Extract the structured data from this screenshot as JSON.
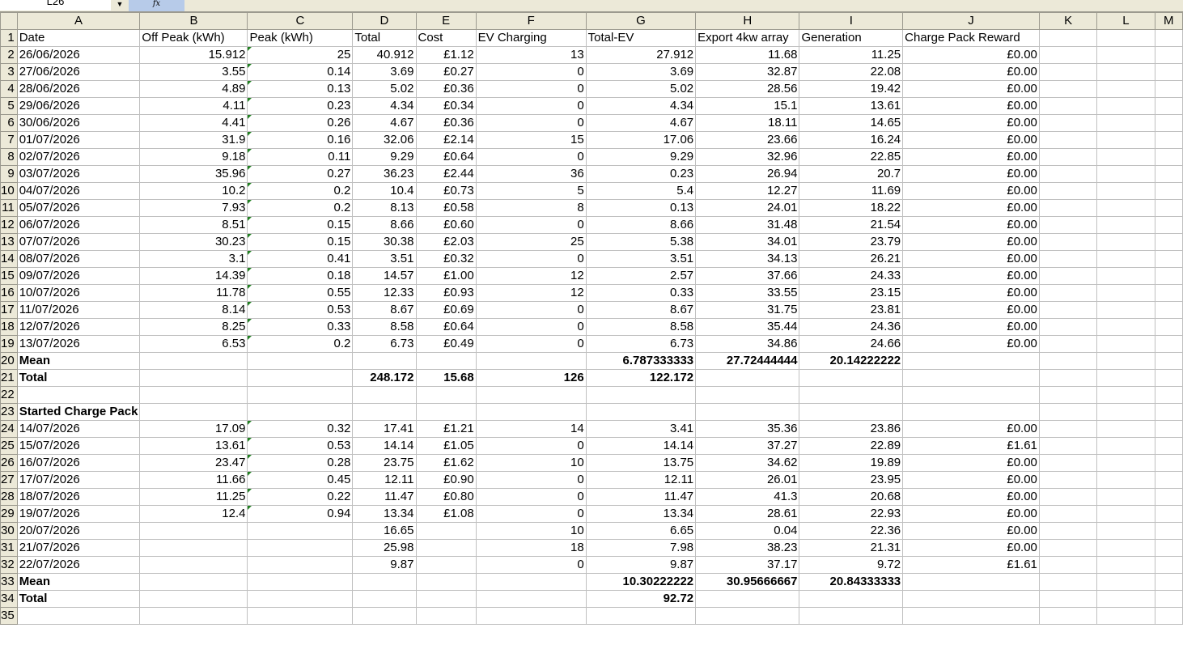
{
  "toolbar": {
    "namebox": "L26",
    "fx": "fx"
  },
  "columns": [
    "A",
    "B",
    "C",
    "D",
    "E",
    "F",
    "G",
    "H",
    "I",
    "J",
    "K",
    "L",
    "M"
  ],
  "row_numbers": [
    "1",
    "2",
    "3",
    "4",
    "5",
    "6",
    "7",
    "8",
    "9",
    "10",
    "11",
    "12",
    "13",
    "14",
    "15",
    "16",
    "17",
    "18",
    "19",
    "20",
    "21",
    "22",
    "23",
    "24",
    "25",
    "26",
    "27",
    "28",
    "29",
    "30",
    "31",
    "32",
    "33",
    "34",
    "35"
  ],
  "headers": [
    "Date",
    "Off Peak (kWh)",
    "Peak (kWh)",
    "Total",
    "Cost",
    "EV Charging",
    "Total-EV",
    "Export 4kw array",
    "Generation",
    "Charge Pack Reward"
  ],
  "rows1": [
    [
      "26/06/2026",
      "15.912",
      "25",
      "40.912",
      "£1.12",
      "13",
      "27.912",
      "11.68",
      "11.25",
      "£0.00"
    ],
    [
      "27/06/2026",
      "3.55",
      "0.14",
      "3.69",
      "£0.27",
      "0",
      "3.69",
      "32.87",
      "22.08",
      "£0.00"
    ],
    [
      "28/06/2026",
      "4.89",
      "0.13",
      "5.02",
      "£0.36",
      "0",
      "5.02",
      "28.56",
      "19.42",
      "£0.00"
    ],
    [
      "29/06/2026",
      "4.11",
      "0.23",
      "4.34",
      "£0.34",
      "0",
      "4.34",
      "15.1",
      "13.61",
      "£0.00"
    ],
    [
      "30/06/2026",
      "4.41",
      "0.26",
      "4.67",
      "£0.36",
      "0",
      "4.67",
      "18.11",
      "14.65",
      "£0.00"
    ],
    [
      "01/07/2026",
      "31.9",
      "0.16",
      "32.06",
      "£2.14",
      "15",
      "17.06",
      "23.66",
      "16.24",
      "£0.00"
    ],
    [
      "02/07/2026",
      "9.18",
      "0.11",
      "9.29",
      "£0.64",
      "0",
      "9.29",
      "32.96",
      "22.85",
      "£0.00"
    ],
    [
      "03/07/2026",
      "35.96",
      "0.27",
      "36.23",
      "£2.44",
      "36",
      "0.23",
      "26.94",
      "20.7",
      "£0.00"
    ],
    [
      "04/07/2026",
      "10.2",
      "0.2",
      "10.4",
      "£0.73",
      "5",
      "5.4",
      "12.27",
      "11.69",
      "£0.00"
    ],
    [
      "05/07/2026",
      "7.93",
      "0.2",
      "8.13",
      "£0.58",
      "8",
      "0.13",
      "24.01",
      "18.22",
      "£0.00"
    ],
    [
      "06/07/2026",
      "8.51",
      "0.15",
      "8.66",
      "£0.60",
      "0",
      "8.66",
      "31.48",
      "21.54",
      "£0.00"
    ],
    [
      "07/07/2026",
      "30.23",
      "0.15",
      "30.38",
      "£2.03",
      "25",
      "5.38",
      "34.01",
      "23.79",
      "£0.00"
    ],
    [
      "08/07/2026",
      "3.1",
      "0.41",
      "3.51",
      "£0.32",
      "0",
      "3.51",
      "34.13",
      "26.21",
      "£0.00"
    ],
    [
      "09/07/2026",
      "14.39",
      "0.18",
      "14.57",
      "£1.00",
      "12",
      "2.57",
      "37.66",
      "24.33",
      "£0.00"
    ],
    [
      "10/07/2026",
      "11.78",
      "0.55",
      "12.33",
      "£0.93",
      "12",
      "0.33",
      "33.55",
      "23.15",
      "£0.00"
    ],
    [
      "11/07/2026",
      "8.14",
      "0.53",
      "8.67",
      "£0.69",
      "0",
      "8.67",
      "31.75",
      "23.81",
      "£0.00"
    ],
    [
      "12/07/2026",
      "8.25",
      "0.33",
      "8.58",
      "£0.64",
      "0",
      "8.58",
      "35.44",
      "24.36",
      "£0.00"
    ],
    [
      "13/07/2026",
      "6.53",
      "0.2",
      "6.73",
      "£0.49",
      "0",
      "6.73",
      "34.86",
      "24.66",
      "£0.00"
    ]
  ],
  "summary1": {
    "mean_label": "Mean",
    "mean_g": "6.787333333",
    "mean_h": "27.72444444",
    "mean_i": "20.14222222",
    "total_label": "Total",
    "total_d": "248.172",
    "total_e": "15.68",
    "total_f": "126",
    "total_g": "122.172"
  },
  "section2_label": "Started Charge Pack",
  "rows2": [
    [
      "14/07/2026",
      "17.09",
      "0.32",
      "17.41",
      "£1.21",
      "14",
      "3.41",
      "35.36",
      "23.86",
      "£0.00"
    ],
    [
      "15/07/2026",
      "13.61",
      "0.53",
      "14.14",
      "£1.05",
      "0",
      "14.14",
      "37.27",
      "22.89",
      "£1.61"
    ],
    [
      "16/07/2026",
      "23.47",
      "0.28",
      "23.75",
      "£1.62",
      "10",
      "13.75",
      "34.62",
      "19.89",
      "£0.00"
    ],
    [
      "17/07/2026",
      "11.66",
      "0.45",
      "12.11",
      "£0.90",
      "0",
      "12.11",
      "26.01",
      "23.95",
      "£0.00"
    ],
    [
      "18/07/2026",
      "11.25",
      "0.22",
      "11.47",
      "£0.80",
      "0",
      "11.47",
      "41.3",
      "20.68",
      "£0.00"
    ],
    [
      "19/07/2026",
      "12.4",
      "0.94",
      "13.34",
      "£1.08",
      "0",
      "13.34",
      "28.61",
      "22.93",
      "£0.00"
    ],
    [
      "20/07/2026",
      "",
      "",
      "16.65",
      "",
      "10",
      "6.65",
      "0.04",
      "22.36",
      "£0.00"
    ],
    [
      "21/07/2026",
      "",
      "",
      "25.98",
      "",
      "18",
      "7.98",
      "38.23",
      "21.31",
      "£0.00"
    ],
    [
      "22/07/2026",
      "",
      "",
      "9.87",
      "",
      "0",
      "9.87",
      "37.17",
      "9.72",
      "£1.61"
    ]
  ],
  "summary2": {
    "mean_label": "Mean",
    "mean_g": "10.30222222",
    "mean_h": "30.95666667",
    "mean_i": "20.84333333",
    "total_label": "Total",
    "total_g": "92.72"
  }
}
